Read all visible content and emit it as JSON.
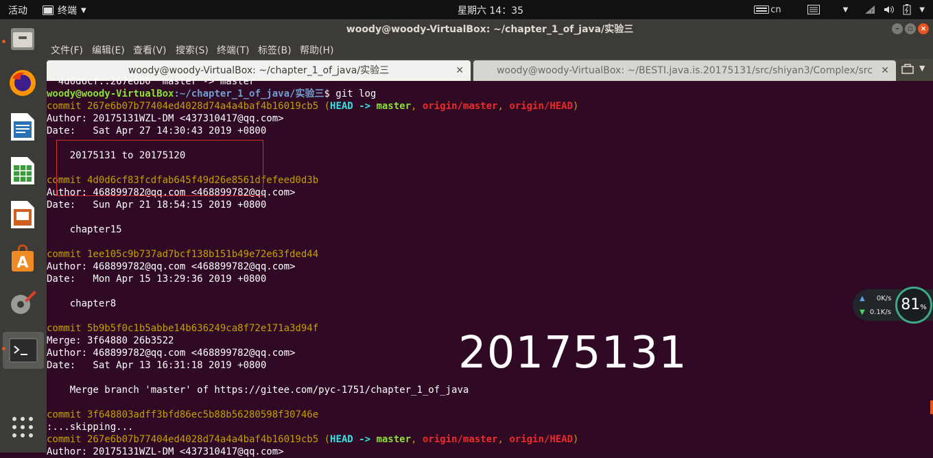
{
  "topbar": {
    "activities": "活动",
    "app_name": "终端",
    "clock": "星期六 14：35",
    "input_method": "cn"
  },
  "window": {
    "title": "woody@woody-VirtualBox: ~/chapter_1_of_java/实验三",
    "menu": [
      "文件(F)",
      "编辑(E)",
      "查看(V)",
      "搜索(S)",
      "终端(T)",
      "标签(B)",
      "帮助(H)"
    ],
    "tabs": [
      {
        "label": "woody@woody-VirtualBox: ~/chapter_1_of_java/实验三",
        "active": true
      },
      {
        "label": "woody@woody-VirtualBox: ~/BESTI.java.is.20175131/src/shiyan3/Complex/src",
        "active": false
      }
    ]
  },
  "terminal": {
    "partial_top": "  4d0d6cf..267e6b0  master -> master",
    "prompt_user": "woody@woody-VirtualBox",
    "prompt_path": ":~/chapter_1_of_java/实验三",
    "prompt_cmd": "$ git log",
    "commits": [
      {
        "hash": "commit 267e6b07b77404ed4028d74a4a4baf4b16019cb5",
        "refs": true,
        "author": "Author: 20175131WZL-DM <437310417@qq.com>",
        "date": "Date:   Sat Apr 27 14:30:43 2019 +0800",
        "message": "    20175131 to 20175120"
      },
      {
        "hash": "commit 4d0d6cf83fcdfab645f49d26e8561dfefeed0d3b",
        "author": "Author: 468899782@qq.com <468899782@qq.com>",
        "date": "Date:   Sun Apr 21 18:54:15 2019 +0800",
        "message": "    chapter15"
      },
      {
        "hash": "commit 1ee105c9b737ad7bcf138b151b49e72e63fded44",
        "author": "Author: 468899782@qq.com <468899782@qq.com>",
        "date": "Date:   Mon Apr 15 13:29:36 2019 +0800",
        "message": "    chapter8"
      },
      {
        "hash": "commit 5b9b5f0c1b5abbe14b636249ca8f72e171a3d94f",
        "merge": "Merge: 3f64880 26b3522",
        "author": "Author: 468899782@qq.com <468899782@qq.com>",
        "date": "Date:   Sat Apr 13 16:31:18 2019 +0800",
        "message": "    Merge branch 'master' of https://gitee.com/pyc-1751/chapter_1_of_java"
      },
      {
        "hash": "commit 3f648803adff3bfd86ec5b88b56280598f30746e"
      }
    ],
    "skipping": ":...skipping...",
    "repeat_hash": "commit 267e6b07b77404ed4028d74a4a4baf4b16019cb5",
    "repeat_author_partial": "Author: 20175131WZL-DM <437310417@qq.com>",
    "refs": {
      "open": " (",
      "head": "HEAD -> ",
      "master": "master",
      "sep1": ", ",
      "origin_master": "origin/master",
      "sep2": ", ",
      "origin_head": "origin/HEAD",
      "close": ")"
    }
  },
  "watermark": "20175131",
  "netwidget": {
    "up": "0K/s",
    "down": "0.1K/s",
    "percent": "81",
    "percent_unit": "%"
  },
  "colors": {
    "accent": "#e95420",
    "terminal_bg": "#300a24",
    "commit_yellow": "#c4a000"
  }
}
